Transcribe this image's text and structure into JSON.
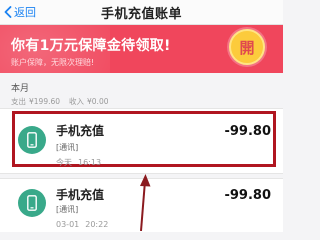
{
  "nav": {
    "back_label": "返回",
    "title": "手机充值账单"
  },
  "banner": {
    "title": "你有1万元保障金待领取!",
    "subtitle": "账户保障，无限次理赔!",
    "badge": "開",
    "background": "#f0465c",
    "badge_color": "#fccb3c"
  },
  "month": {
    "label": "本月",
    "expense_label": "支出",
    "expense_value": "¥199.60",
    "income_label": "收入",
    "income_value": "¥0.00"
  },
  "transactions": [
    {
      "title": "手机充值",
      "tag": "[通讯]",
      "date": "今天",
      "time": "16:13",
      "amount": "-99.80",
      "icon": "phone-icon"
    },
    {
      "title": "手机充值",
      "tag": "[通讯]",
      "date": "03-01",
      "time": "20:22",
      "amount": "-99.80",
      "icon": "phone-icon"
    }
  ],
  "colors": {
    "accent": "#1a82f2",
    "icon_bg": "#39a98a",
    "annotation": "#b01620"
  }
}
